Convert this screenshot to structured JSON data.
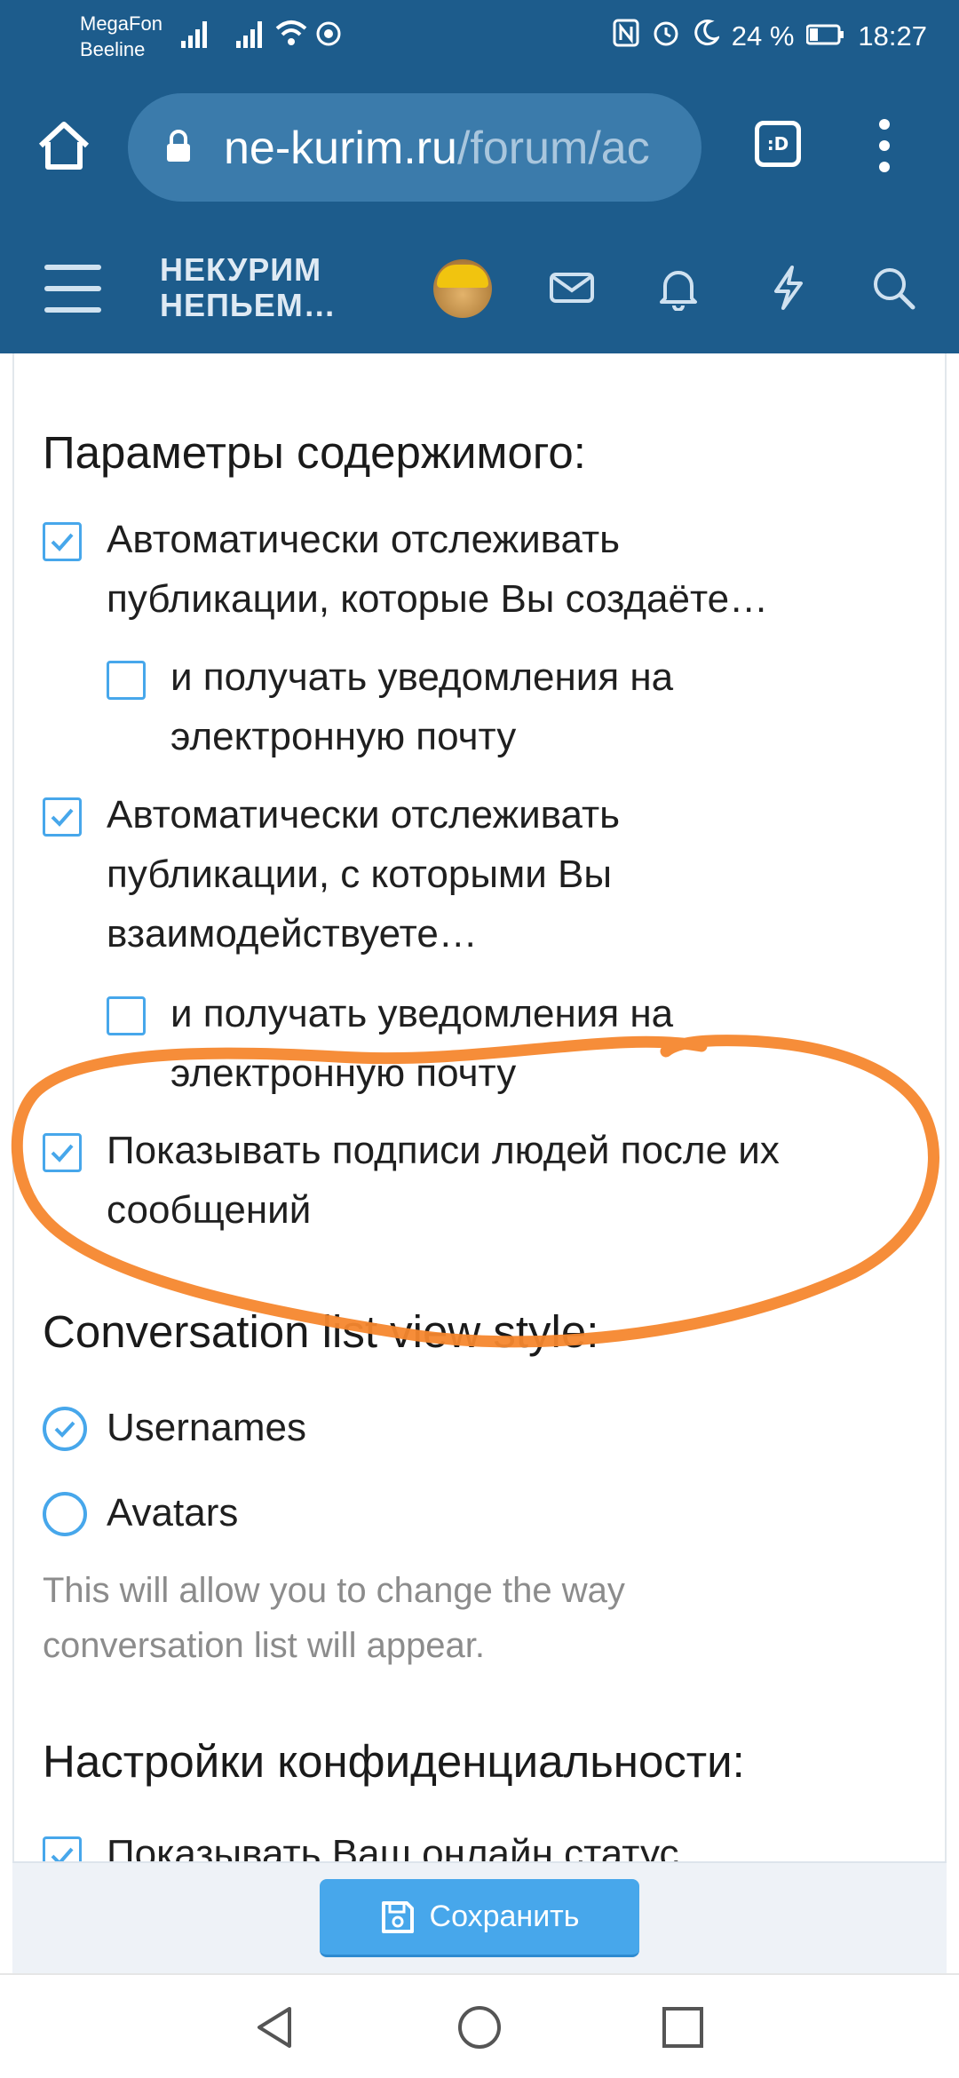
{
  "status_bar": {
    "carrier1": "MegaFon",
    "carrier2": "Beeline",
    "battery": "24 %",
    "time": "18:27"
  },
  "browser": {
    "url_host": "ne-kurim.ru",
    "url_path": "/forum/ac",
    "tab_label": ":D"
  },
  "forum_header": {
    "logo_line1": "НЕКУРИМ",
    "logo_line2": "НЕПЬЕМ…"
  },
  "content_section": {
    "heading": "Параметры содержимого:",
    "option1": {
      "line1": "Автоматически отслеживать",
      "line2": "публикации, которые Вы создаёте…",
      "checked": true
    },
    "option1_sub": {
      "line1": "и получать уведомления на",
      "line2": "электронную почту",
      "checked": false
    },
    "option2": {
      "line1": "Автоматически отслеживать",
      "line2": "публикации, с которыми Вы",
      "line3": "взаимодействуете…",
      "checked": true
    },
    "option2_sub": {
      "line1": "и получать уведомления на",
      "line2": "электронную почту",
      "checked": false
    },
    "option3": {
      "line1": "Показывать подписи людей после их",
      "line2": "сообщений",
      "checked": true
    }
  },
  "conversation_section": {
    "heading": "Conversation list view style:",
    "radio_usernames": "Usernames",
    "radio_avatars": "Avatars",
    "selected": "Usernames",
    "hint_line1": "This will allow you to change the way",
    "hint_line2": "conversation list will appear."
  },
  "privacy_section": {
    "heading": "Настройки конфиденциальности:",
    "option1": "Показывать Ваш онлайн статус"
  },
  "save_button": {
    "label": "Сохранить"
  },
  "colors": {
    "header_blue": "#1d5c8c",
    "accent_blue": "#47a7eb",
    "annotation_orange": "#f5872e"
  }
}
